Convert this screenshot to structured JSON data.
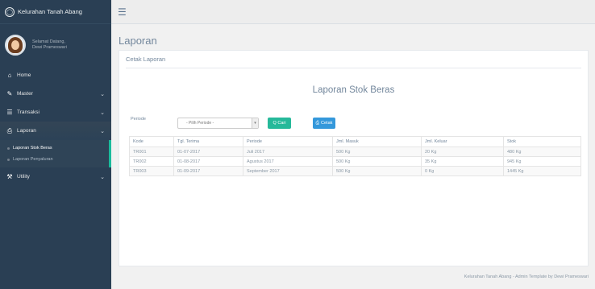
{
  "app": {
    "brand": "Kelurahan Tanah Abang",
    "menu_icon": "hamburger-icon"
  },
  "profile": {
    "line1": "Selamat Datang,",
    "line2": "Dewi Prameswari"
  },
  "sidebar": {
    "items": [
      {
        "icon": "home-icon",
        "label": "Home",
        "has_chevron": false
      },
      {
        "icon": "edit-icon",
        "label": "Master",
        "has_chevron": true
      },
      {
        "icon": "table-icon",
        "label": "Transaksi",
        "has_chevron": true
      },
      {
        "icon": "print-icon",
        "label": "Laporan",
        "has_chevron": true
      },
      {
        "icon": "wrench-icon",
        "label": "Utility",
        "has_chevron": true
      }
    ],
    "submenu": [
      {
        "label": "Laporan Stok Beras"
      },
      {
        "label": "Laporan Penyaluran"
      }
    ]
  },
  "page": {
    "title": "Laporan",
    "panel_title": "Cetak Laporan",
    "report_title": "Laporan Stok Beras"
  },
  "filter": {
    "label": "Periode",
    "select_value": "- Pilih Periode -",
    "search_button": "Q Cari",
    "print_button": "Cetak"
  },
  "table": {
    "headers": [
      "Kode",
      "Tgl. Terima",
      "Periode",
      "Jml. Masuk",
      "Jml. Keluar",
      "Stok"
    ],
    "rows": [
      [
        "TR001",
        "01-07-2017",
        "Juli 2017",
        "500 Kg",
        "20 Kg",
        "480 Kg"
      ],
      [
        "TR002",
        "01-08-2017",
        "Agustus 2017",
        "500 Kg",
        "35 Kg",
        "945 Kg"
      ],
      [
        "TR003",
        "01-09-2017",
        "September 2017",
        "500 Kg",
        "0 Kg",
        "1445 Kg"
      ]
    ]
  },
  "footer": {
    "text": "Kelurahan Tanah Abang - Admin Template by Dewi Prameswari"
  },
  "colors": {
    "sidebar": "#2a3f54",
    "accent_green": "#26b99a",
    "accent_blue": "#3498db",
    "active_border": "#1abb9c"
  }
}
